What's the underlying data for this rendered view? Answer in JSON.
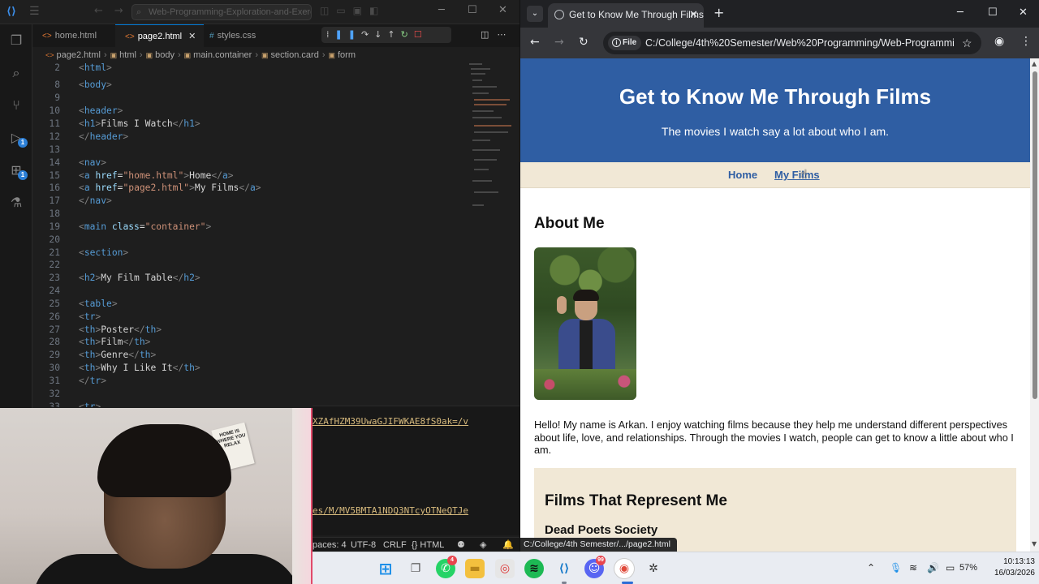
{
  "vscode": {
    "search_text": "Web-Programming-Exploration-and-Exercise",
    "tabs": [
      {
        "label": "home.html"
      },
      {
        "label": "page2.html",
        "close": "✕"
      },
      {
        "label": "styles.css"
      }
    ],
    "breadcrumb": [
      "page2.html",
      "html",
      "body",
      "main.container",
      "section.card",
      "form"
    ],
    "badge_run": "1",
    "badge_ext": "1",
    "terminal_lines": [
      "XZAfHZM39UwaGJIFWKAE8fS0ak=/v",
      "es/M/MV5BMTA1NDQ3NTcyOTNeQTJe"
    ],
    "statusbar": {
      "spaces": "paces: 4",
      "encoding": "UTF-8",
      "eol": "CRLF",
      "language": "{} HTML"
    }
  },
  "chrome": {
    "tab_title": "Get to Know Me Through Films",
    "tab_close": "✕",
    "new_tab": "+",
    "url_chip": "File",
    "url": "C:/College/4th%20Semester/Web%20Programming/Web-Programming...",
    "status_url": "C:/College/4th Semester/.../page2.html"
  },
  "site": {
    "header_title": "Get to Know Me Through Films",
    "header_subtitle": "The movies I watch say a lot about who I am.",
    "nav": [
      "Home",
      "My Films"
    ],
    "about_heading": "About Me",
    "intro": "Hello! My name is Arkan. I enjoy watching films because they help me understand different perspectives about life, love, and relationships. Through the movies I watch, people can get to know a little about who I am.",
    "films_heading": "Films That Represent Me",
    "film_title": "Dead Poets Society"
  },
  "taskbar": {
    "whatsapp_badge": "4",
    "discord_badge": "99",
    "battery": "57%",
    "time": "10:13:13",
    "date": "16/03/2026"
  },
  "webcam": {
    "poster_text": "HOME IS WHERE YOU RELAX"
  },
  "colors": {
    "header_bg": "#2f5ea3",
    "nav_bg": "#f1e8d6",
    "vscode_accent": "#0078d4"
  }
}
